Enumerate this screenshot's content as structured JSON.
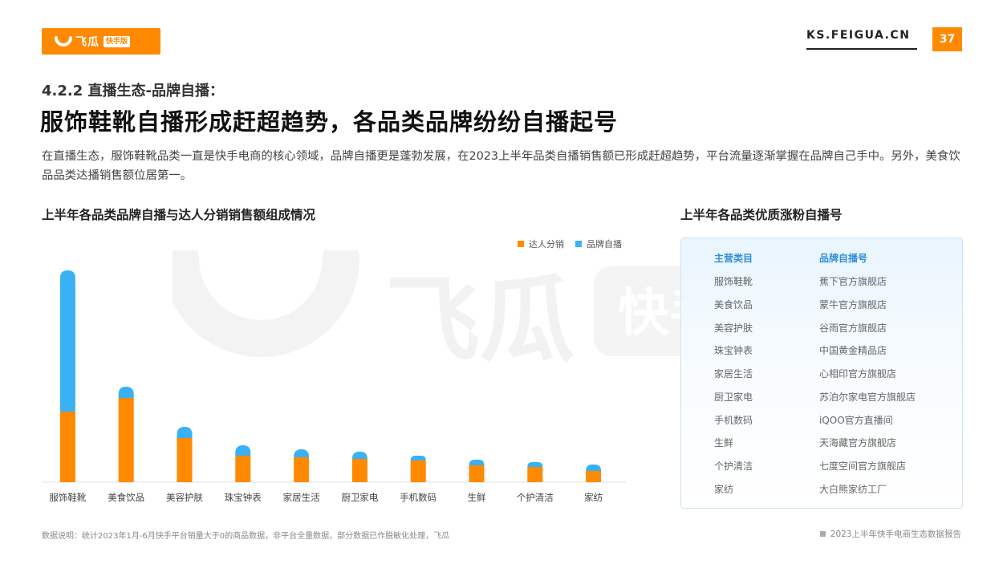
{
  "header": {
    "logo_text": "飞瓜",
    "logo_badge": "快手版",
    "site": "KS.FEIGUA.CN",
    "page_number": "37"
  },
  "subtitle": "4.2.2 直播生态-品牌自播：",
  "title": "服饰鞋靴自播形成赶超趋势，各品类品牌纷纷自播起号",
  "description": "在直播生态，服饰鞋靴品类一直是快手电商的核心领域，品牌自播更是蓬勃发展，在2023上半年品类自播销售额已形成赶超趋势，平台流量逐渐掌握在品牌自己手中。另外，美食饮品品类达播销售额位居第一。",
  "watermark": {
    "brand": "飞瓜",
    "badge": "快手版"
  },
  "chart_title": "上半年各品类品牌自播与达人分销销售额组成情况",
  "chart_data": {
    "type": "bar",
    "stacked": true,
    "categories": [
      "服饰鞋靴",
      "美食饮品",
      "美容护肤",
      "珠宝钟表",
      "家居生活",
      "厨卫家电",
      "手机数码",
      "生鲜",
      "个护清洁",
      "家纺"
    ],
    "series": [
      {
        "name": "达人分销",
        "color": "#ff8a00",
        "values": [
          88,
          105,
          55,
          33,
          31,
          29,
          27,
          21,
          19,
          14
        ]
      },
      {
        "name": "品牌自播",
        "color": "#3ab0f5",
        "values": [
          176,
          14,
          14,
          13,
          10,
          9,
          6,
          7,
          6,
          8
        ]
      }
    ],
    "ylim": [
      0,
      270
    ],
    "grid": false,
    "legend": "top-right"
  },
  "table_title": "上半年各品类优质涨粉自播号",
  "table": {
    "headers": [
      "主营类目",
      "品牌自播号"
    ],
    "rows": [
      [
        "服饰鞋靴",
        "蕉下官方旗舰店"
      ],
      [
        "美食饮品",
        "蒙牛官方旗舰店"
      ],
      [
        "美容护肤",
        "谷雨官方旗舰店"
      ],
      [
        "珠宝钟表",
        "中国黄金精品店"
      ],
      [
        "家居生活",
        "心相印官方旗舰店"
      ],
      [
        "厨卫家电",
        "苏泊尔家电官方旗舰店"
      ],
      [
        "手机数码",
        "iQOO官方直播间"
      ],
      [
        "生鲜",
        "天海藏官方旗舰店"
      ],
      [
        "个护清洁",
        "七度空间官方旗舰店"
      ],
      [
        "家纺",
        "大白熊家纺工厂"
      ]
    ]
  },
  "footnote": "数据说明：统计2023年1月-6月快手平台销量大于0的商品数据，非平台全量数据，部分数据已作脱敏化处理，飞瓜",
  "report_name": "2023上半年快手电商生态数据报告"
}
